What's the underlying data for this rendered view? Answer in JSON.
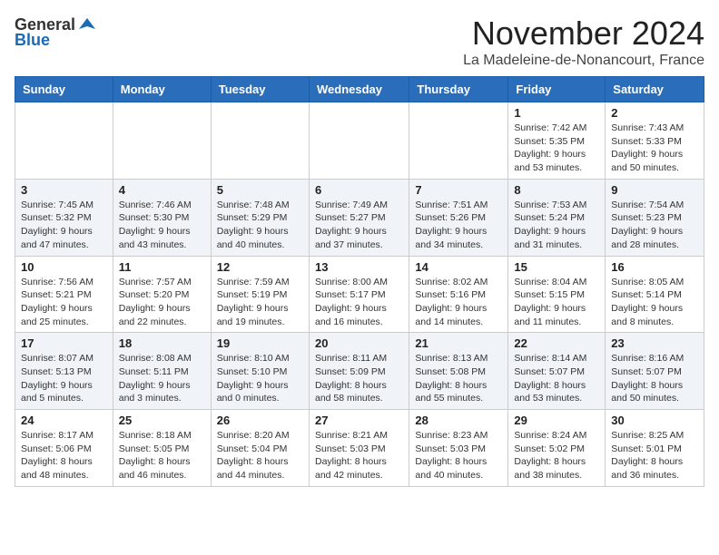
{
  "header": {
    "logo_general": "General",
    "logo_blue": "Blue",
    "month": "November 2024",
    "location": "La Madeleine-de-Nonancourt, France"
  },
  "weekdays": [
    "Sunday",
    "Monday",
    "Tuesday",
    "Wednesday",
    "Thursday",
    "Friday",
    "Saturday"
  ],
  "weeks": [
    [
      {
        "day": "",
        "info": ""
      },
      {
        "day": "",
        "info": ""
      },
      {
        "day": "",
        "info": ""
      },
      {
        "day": "",
        "info": ""
      },
      {
        "day": "",
        "info": ""
      },
      {
        "day": "1",
        "info": "Sunrise: 7:42 AM\nSunset: 5:35 PM\nDaylight: 9 hours\nand 53 minutes."
      },
      {
        "day": "2",
        "info": "Sunrise: 7:43 AM\nSunset: 5:33 PM\nDaylight: 9 hours\nand 50 minutes."
      }
    ],
    [
      {
        "day": "3",
        "info": "Sunrise: 7:45 AM\nSunset: 5:32 PM\nDaylight: 9 hours\nand 47 minutes."
      },
      {
        "day": "4",
        "info": "Sunrise: 7:46 AM\nSunset: 5:30 PM\nDaylight: 9 hours\nand 43 minutes."
      },
      {
        "day": "5",
        "info": "Sunrise: 7:48 AM\nSunset: 5:29 PM\nDaylight: 9 hours\nand 40 minutes."
      },
      {
        "day": "6",
        "info": "Sunrise: 7:49 AM\nSunset: 5:27 PM\nDaylight: 9 hours\nand 37 minutes."
      },
      {
        "day": "7",
        "info": "Sunrise: 7:51 AM\nSunset: 5:26 PM\nDaylight: 9 hours\nand 34 minutes."
      },
      {
        "day": "8",
        "info": "Sunrise: 7:53 AM\nSunset: 5:24 PM\nDaylight: 9 hours\nand 31 minutes."
      },
      {
        "day": "9",
        "info": "Sunrise: 7:54 AM\nSunset: 5:23 PM\nDaylight: 9 hours\nand 28 minutes."
      }
    ],
    [
      {
        "day": "10",
        "info": "Sunrise: 7:56 AM\nSunset: 5:21 PM\nDaylight: 9 hours\nand 25 minutes."
      },
      {
        "day": "11",
        "info": "Sunrise: 7:57 AM\nSunset: 5:20 PM\nDaylight: 9 hours\nand 22 minutes."
      },
      {
        "day": "12",
        "info": "Sunrise: 7:59 AM\nSunset: 5:19 PM\nDaylight: 9 hours\nand 19 minutes."
      },
      {
        "day": "13",
        "info": "Sunrise: 8:00 AM\nSunset: 5:17 PM\nDaylight: 9 hours\nand 16 minutes."
      },
      {
        "day": "14",
        "info": "Sunrise: 8:02 AM\nSunset: 5:16 PM\nDaylight: 9 hours\nand 14 minutes."
      },
      {
        "day": "15",
        "info": "Sunrise: 8:04 AM\nSunset: 5:15 PM\nDaylight: 9 hours\nand 11 minutes."
      },
      {
        "day": "16",
        "info": "Sunrise: 8:05 AM\nSunset: 5:14 PM\nDaylight: 9 hours\nand 8 minutes."
      }
    ],
    [
      {
        "day": "17",
        "info": "Sunrise: 8:07 AM\nSunset: 5:13 PM\nDaylight: 9 hours\nand 5 minutes."
      },
      {
        "day": "18",
        "info": "Sunrise: 8:08 AM\nSunset: 5:11 PM\nDaylight: 9 hours\nand 3 minutes."
      },
      {
        "day": "19",
        "info": "Sunrise: 8:10 AM\nSunset: 5:10 PM\nDaylight: 9 hours\nand 0 minutes."
      },
      {
        "day": "20",
        "info": "Sunrise: 8:11 AM\nSunset: 5:09 PM\nDaylight: 8 hours\nand 58 minutes."
      },
      {
        "day": "21",
        "info": "Sunrise: 8:13 AM\nSunset: 5:08 PM\nDaylight: 8 hours\nand 55 minutes."
      },
      {
        "day": "22",
        "info": "Sunrise: 8:14 AM\nSunset: 5:07 PM\nDaylight: 8 hours\nand 53 minutes."
      },
      {
        "day": "23",
        "info": "Sunrise: 8:16 AM\nSunset: 5:07 PM\nDaylight: 8 hours\nand 50 minutes."
      }
    ],
    [
      {
        "day": "24",
        "info": "Sunrise: 8:17 AM\nSunset: 5:06 PM\nDaylight: 8 hours\nand 48 minutes."
      },
      {
        "day": "25",
        "info": "Sunrise: 8:18 AM\nSunset: 5:05 PM\nDaylight: 8 hours\nand 46 minutes."
      },
      {
        "day": "26",
        "info": "Sunrise: 8:20 AM\nSunset: 5:04 PM\nDaylight: 8 hours\nand 44 minutes."
      },
      {
        "day": "27",
        "info": "Sunrise: 8:21 AM\nSunset: 5:03 PM\nDaylight: 8 hours\nand 42 minutes."
      },
      {
        "day": "28",
        "info": "Sunrise: 8:23 AM\nSunset: 5:03 PM\nDaylight: 8 hours\nand 40 minutes."
      },
      {
        "day": "29",
        "info": "Sunrise: 8:24 AM\nSunset: 5:02 PM\nDaylight: 8 hours\nand 38 minutes."
      },
      {
        "day": "30",
        "info": "Sunrise: 8:25 AM\nSunset: 5:01 PM\nDaylight: 8 hours\nand 36 minutes."
      }
    ]
  ]
}
